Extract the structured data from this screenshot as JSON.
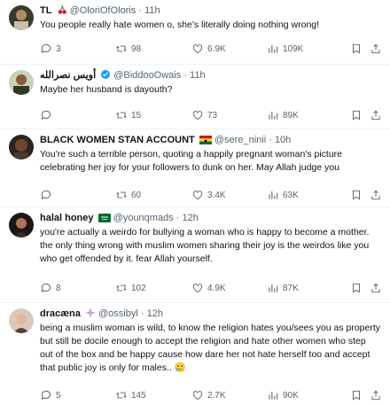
{
  "tweets": [
    {
      "name": "TL",
      "handle": "@OloriOfOloris",
      "time": "11h",
      "text": "You people really hate women o, she's literally doing nothing wrong!",
      "replies": "3",
      "retweets": "98",
      "likes": "6.9K",
      "views": "109K",
      "badge": "cherries-icon"
    },
    {
      "name": "أويس نصرالله",
      "handle": "@BiddooOwais",
      "time": "11h",
      "text": "Maybe her husband is dayouth?",
      "replies": "",
      "retweets": "15",
      "likes": "73",
      "views": "89K",
      "badge": "verified-icon"
    },
    {
      "name": "BLACK WOMEN STAN ACCOUNT",
      "handle": "@sere_ninii",
      "time": "10h",
      "text": "You're such a terrible person, quoting a happily pregnant woman's picture celebrating her joy for your followers to dunk on her. May Allah judge you",
      "replies": "",
      "retweets": "60",
      "likes": "3.4K",
      "views": "63K",
      "badge": "ghana-flag-icon"
    },
    {
      "name": "halal honey",
      "handle": "@younqmads",
      "time": "12h",
      "text": "you're actually a weirdo for bullying a woman who is happy to become a mother. the only thing wrong with muslim women sharing their joy is the weirdos like you who get offended by it. fear Allah yourself.",
      "replies": "8",
      "retweets": "102",
      "likes": "4.9K",
      "views": "87K",
      "badge": "saudi-flag-icon"
    },
    {
      "name": "dracæna",
      "handle": "@ossibyl",
      "time": "12h",
      "text": "being a muslim woman is wild, to know the religion hates you/sees you as property but still be docile enough to accept the religion and hate other women who step out of the box and be happy cause how dare her not hate herself too and accept that public joy is only for males.. 🥲",
      "replies": "5",
      "retweets": "145",
      "likes": "2.7K",
      "views": "90K",
      "badge": "sparkle-icon"
    }
  ],
  "colors": {
    "text": "#0f1419",
    "muted": "#536471",
    "verified": "#1d9bf0",
    "divider": "#eff3f4"
  }
}
